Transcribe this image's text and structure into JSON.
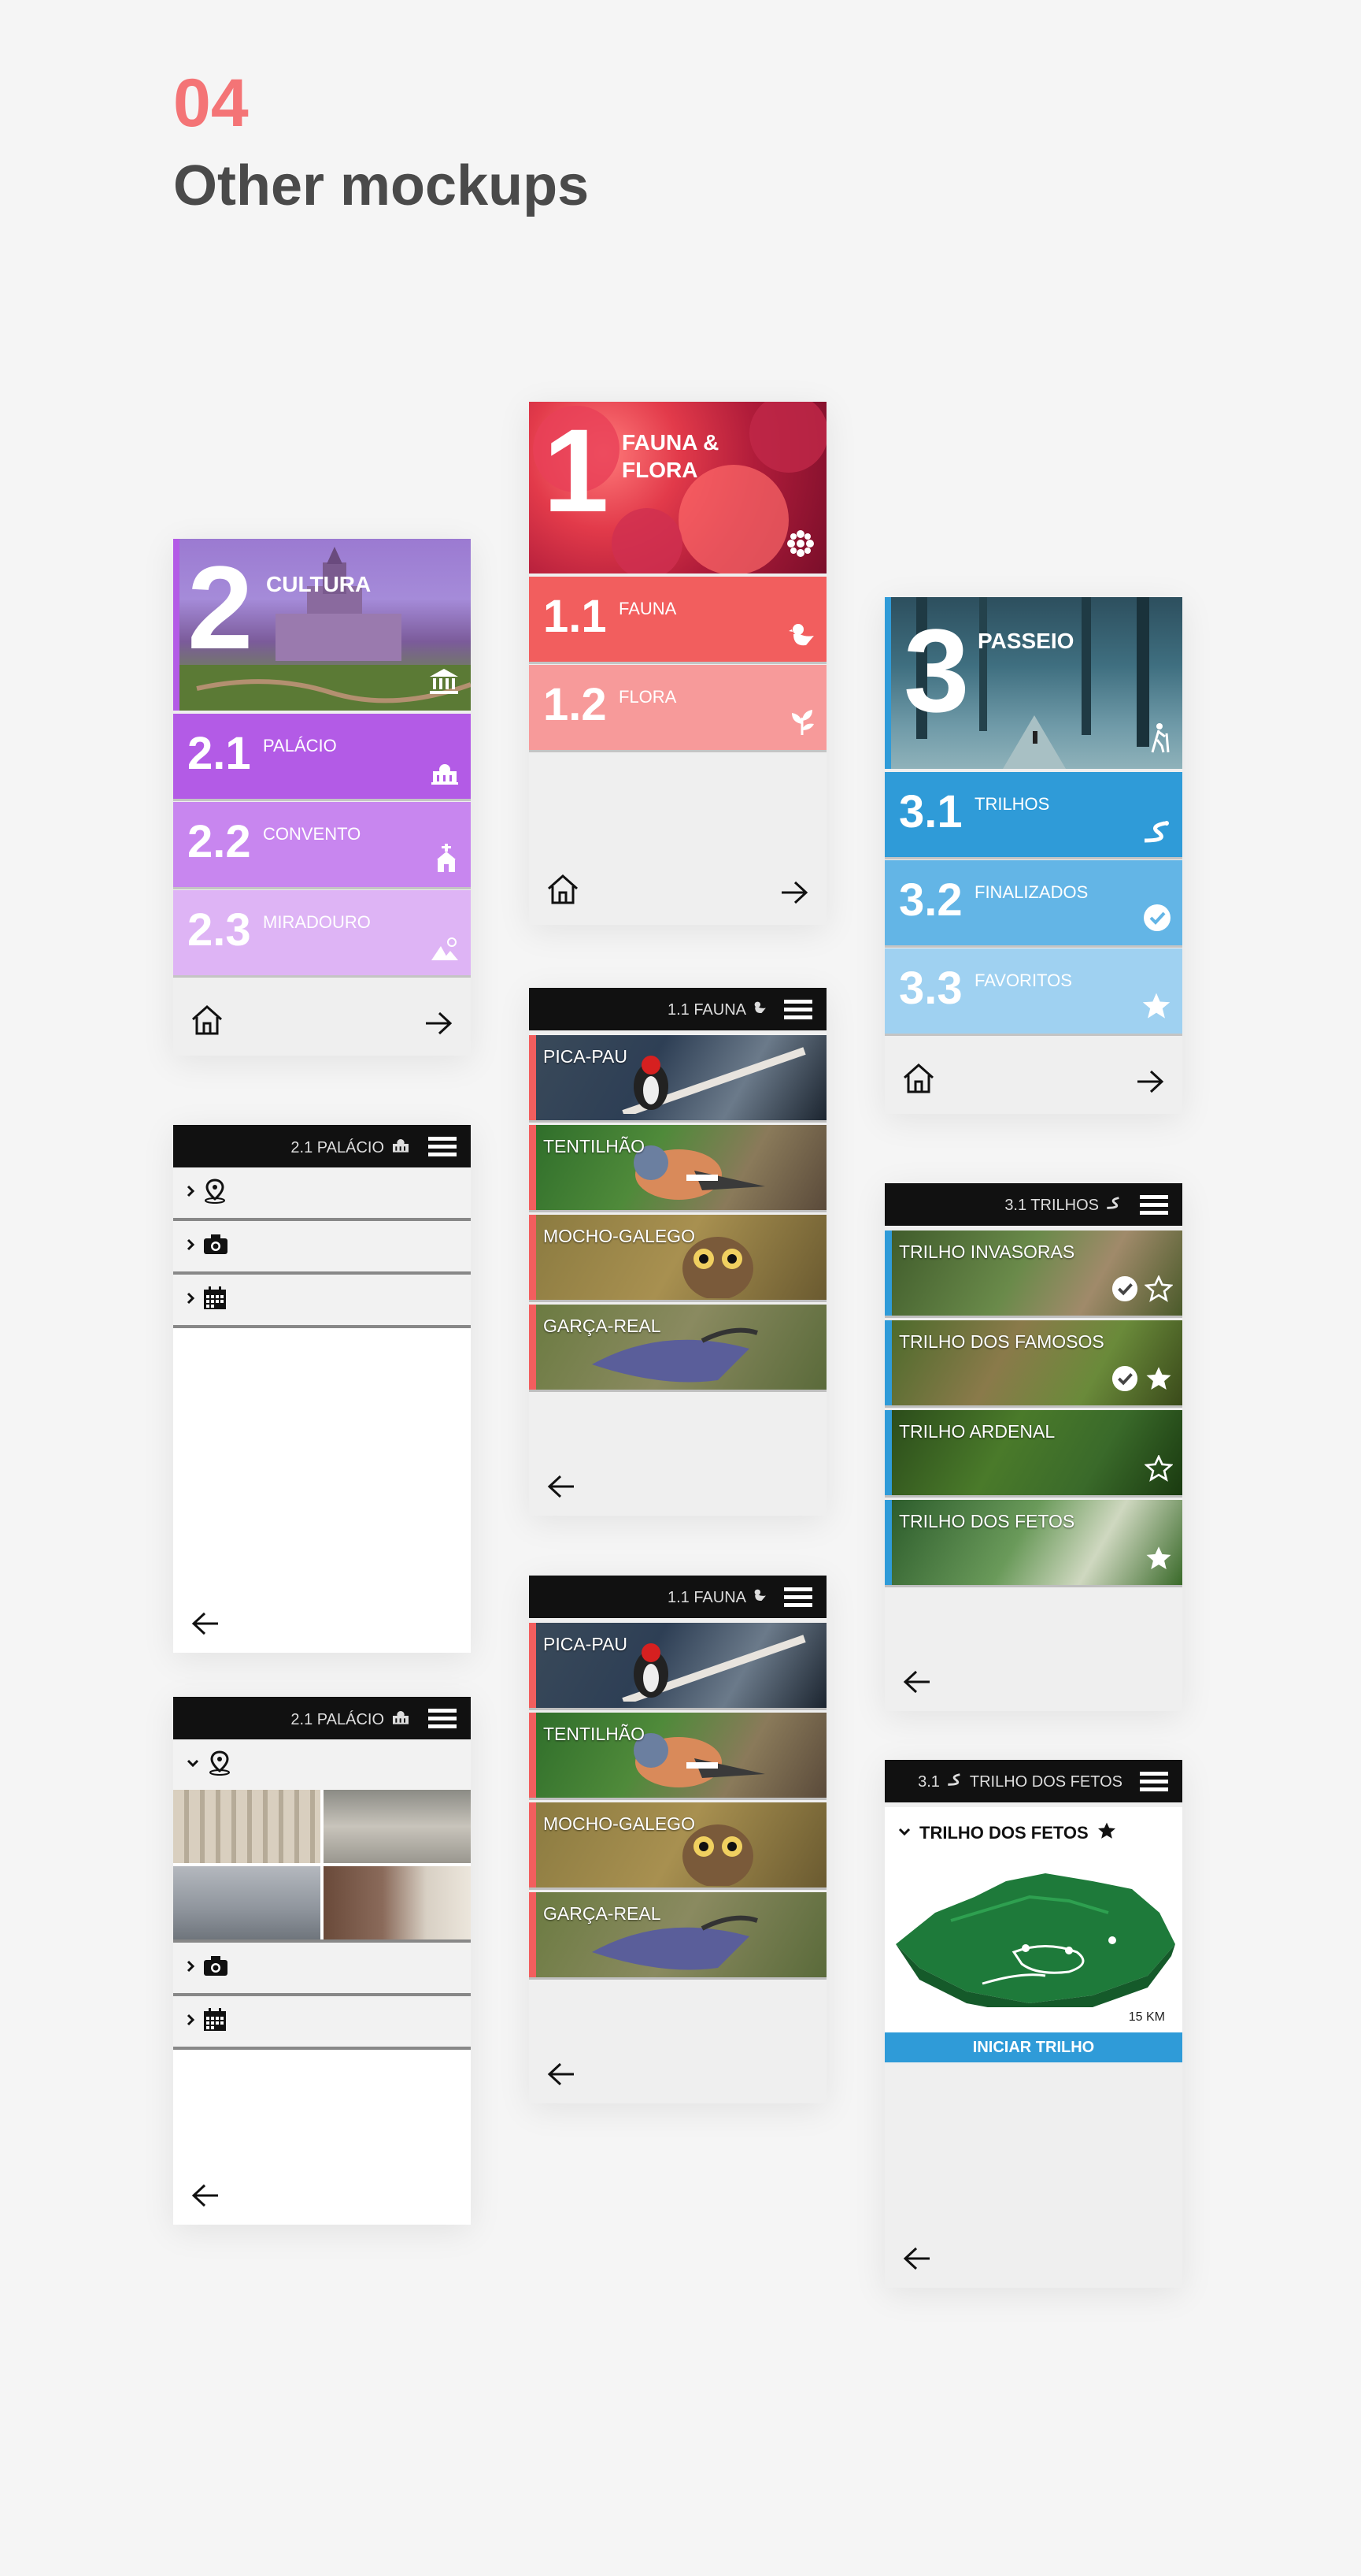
{
  "heading": {
    "number": "04",
    "title": "Other mockups"
  },
  "colors": {
    "accent": "#f47476",
    "cultura": "#b35be6",
    "cultura2": "#c886ef",
    "cultura3": "#deb4f5",
    "fauna": "#f25e5e",
    "flora": "#f79a9a",
    "passeio": "#2f9bd8",
    "passeio2": "#63b5e6",
    "passeio3": "#9fd1f1"
  },
  "cultura": {
    "hero": {
      "number": "2",
      "label": "CULTURA",
      "icon": "museum-icon"
    },
    "items": [
      {
        "number": "2.1",
        "label": "PALÁCIO",
        "icon": "palace-icon"
      },
      {
        "number": "2.2",
        "label": "CONVENTO",
        "icon": "church-icon"
      },
      {
        "number": "2.3",
        "label": "MIRADOURO",
        "icon": "mountain-icon"
      }
    ]
  },
  "fauna_flora": {
    "hero": {
      "number": "1",
      "label": "FAUNA & FLORA",
      "icon": "flower-icon"
    },
    "items": [
      {
        "number": "1.1",
        "label": "FAUNA",
        "icon": "bird-icon"
      },
      {
        "number": "1.2",
        "label": "FLORA",
        "icon": "leaf-icon"
      }
    ]
  },
  "passeio": {
    "hero": {
      "number": "3",
      "label": "PASSEIO",
      "icon": "hiker-icon"
    },
    "items": [
      {
        "number": "3.1",
        "label": "TRILHOS",
        "icon": "trail-icon"
      },
      {
        "number": "3.2",
        "label": "FINALIZADOS",
        "icon": "check-circle-icon"
      },
      {
        "number": "3.3",
        "label": "FAVORITOS",
        "icon": "star-icon"
      }
    ]
  },
  "palacio_list": {
    "title": "2.1 PALÁCIO"
  },
  "palacio_expanded": {
    "title": "2.1 PALÁCIO"
  },
  "fauna_list": {
    "title": "1.1 FAUNA",
    "items": [
      "PICA-PAU",
      "TENTILHÃO",
      "MOCHO-GALEGO",
      "GARÇA-REAL"
    ]
  },
  "fauna_list2": {
    "title": "1.1 FAUNA",
    "items": [
      "PICA-PAU",
      "TENTILHÃO",
      "MOCHO-GALEGO",
      "GARÇA-REAL"
    ]
  },
  "trilhos_list": {
    "title": "3.1 TRILHOS",
    "items": [
      {
        "label": "TRILHO INVASORAS",
        "completed": true,
        "favorite": false
      },
      {
        "label": "TRILHO DOS FAMOSOS",
        "completed": true,
        "favorite": true
      },
      {
        "label": "TRILHO ARDENAL",
        "completed": false,
        "favorite": false
      },
      {
        "label": "TRILHO DOS FETOS",
        "completed": false,
        "favorite": true
      }
    ]
  },
  "trilho_detail": {
    "title": "3.1",
    "subtitle": "TRILHO DOS FETOS",
    "name": "TRILHO DOS FETOS",
    "distance": "15 KM",
    "cta": "INICIAR TRILHO"
  }
}
